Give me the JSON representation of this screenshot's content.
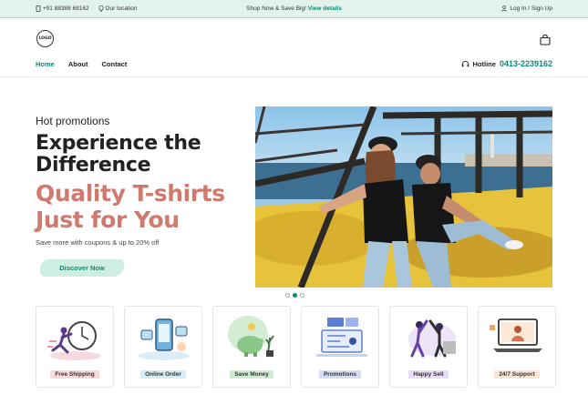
{
  "topbar": {
    "phone": "+91 88388 69162",
    "location": "Our location",
    "promo": "Shop Now & Save Big!",
    "promo_link": "View details",
    "account": "Log In / Sign Up"
  },
  "logo": {
    "text": "LOGO"
  },
  "nav": {
    "items": [
      "Home",
      "About",
      "Contact"
    ],
    "active": "Home"
  },
  "hotline": {
    "label": "Hotline",
    "number": "0413-2239162"
  },
  "hero": {
    "kicker": "Hot promotions",
    "heading_line1": "Experience the",
    "heading_line2": "Difference",
    "accent_line1": "Quality T-shirts",
    "accent_line2": "Just for You",
    "subtext": "Save more with coupons & up to 20% off",
    "cta_label": "Discover Now"
  },
  "carousel": {
    "slides": 3,
    "active_index": 1
  },
  "features": [
    {
      "label": "Free Shipping",
      "tag_color": "#fbd7de",
      "icon": "clock-runner-icon"
    },
    {
      "label": "Online Order",
      "tag_color": "#d3ecf7",
      "icon": "phone-order-icon"
    },
    {
      "label": "Save Money",
      "tag_color": "#cdeed3",
      "icon": "piggy-bank-icon"
    },
    {
      "label": "Promotions",
      "tag_color": "#d6dcf7",
      "icon": "promo-board-icon"
    },
    {
      "label": "Happy Sell",
      "tag_color": "#e6dcf7",
      "icon": "high-five-icon"
    },
    {
      "label": "24/7 Support",
      "tag_color": "#fbe6d3",
      "icon": "support-laptop-icon"
    }
  ],
  "colors": {
    "accent": "#0f8a70",
    "hero_accent": "#d07a6e",
    "topbar_bg": "#e3f2ea"
  }
}
